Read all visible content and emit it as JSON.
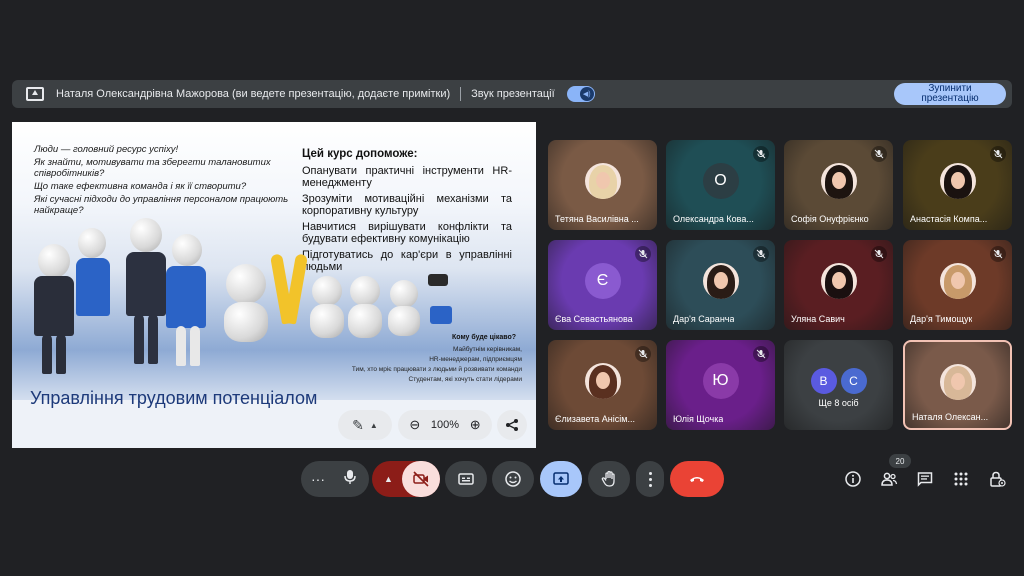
{
  "presentation_bar": {
    "presenter_text": "Наталя Олександрівна Мажорова (ви ведете презентацію, додаєте примітки)",
    "sound_label": "Звук презентації",
    "stop_button": "Зупинити презентацію"
  },
  "slide": {
    "questions": [
      "Люди — головний ресурс успіху!",
      "Як знайти, мотивувати та зберегти талановитих співробітників?",
      "Що таке ефективна команда і як її створити?",
      "Які сучасні підходи до управління персоналом працюють найкраще?"
    ],
    "helps_title": "Цей курс допоможе:",
    "helps_items": [
      "Опанувати практичні інструменти HR-менеджменту",
      "Зрозуміти мотиваційні механізми та корпоративну культуру",
      "Навчитися вирішувати конфлікти та будувати ефективну комунікацію",
      "Підготуватись до кар'єри в управлінні людьми"
    ],
    "who_title": "Кому буде цікаво?",
    "who_lines": [
      "Майбутнім керівникам,",
      "HR-менеджерам, підприємцям",
      "Тим, хто мріє працювати з людьми й розвивати команди",
      "Студентам, які хочуть стати лідерами"
    ],
    "title": "Управління трудовим потенціалом"
  },
  "slide_controls": {
    "zoom_level": "100%"
  },
  "participants": [
    {
      "name": "Тетяна Василівна ...",
      "bg": "#7a5a45",
      "kind": "photo",
      "hair": "#e8d2a8",
      "muted": false
    },
    {
      "name": "Олександра Кова...",
      "bg": "#1f4e55",
      "kind": "letter",
      "letter": "О",
      "letter_bg": "#2c3e44",
      "muted": true
    },
    {
      "name": "Софія Онуфрієнко",
      "bg": "#5b4a36",
      "kind": "photo",
      "hair": "#1d1410",
      "muted": true
    },
    {
      "name": "Анастасія Компа...",
      "bg": "#4a3d1a",
      "kind": "photo",
      "hair": "#1a1210",
      "muted": true
    },
    {
      "name": "Єва Севастьянова",
      "bg": "#6a3bb0",
      "kind": "letter",
      "letter": "Є",
      "letter_bg": "#8a5ad0",
      "muted": true
    },
    {
      "name": "Дар'я Саранча",
      "bg": "#2d4d58",
      "kind": "photo",
      "hair": "#2a1c16",
      "muted": true
    },
    {
      "name": "Уляна Савич",
      "bg": "#5a1e22",
      "kind": "photo",
      "hair": "#1a1010",
      "muted": true
    },
    {
      "name": "Дар'я Тимощук",
      "bg": "#6d3a28",
      "kind": "photo",
      "hair": "#c89a6a",
      "muted": true
    },
    {
      "name": "Єлизавета Анісім...",
      "bg": "#6d4a36",
      "kind": "photo",
      "hair": "#5a3020",
      "muted": true
    },
    {
      "name": "Юлія Щочка",
      "bg": "#6a1f8a",
      "kind": "letter",
      "letter": "Ю",
      "letter_bg": "#8a3aa8",
      "muted": true
    },
    {
      "name": "Ще 8 осіб",
      "bg": "#3c4043",
      "kind": "group",
      "letters": [
        "В",
        "С"
      ],
      "muted": false
    },
    {
      "name": "Наталя Олексан...",
      "bg": "#7a5a4a",
      "kind": "photo",
      "hair": "#d8b898",
      "muted": false,
      "highlight": true
    }
  ],
  "toolbar": {
    "participants_count": "20"
  },
  "colors": {
    "background": "#202124",
    "accent": "#a8c7fa",
    "end_call": "#ea4335",
    "camera_off": "#f9dedc"
  }
}
